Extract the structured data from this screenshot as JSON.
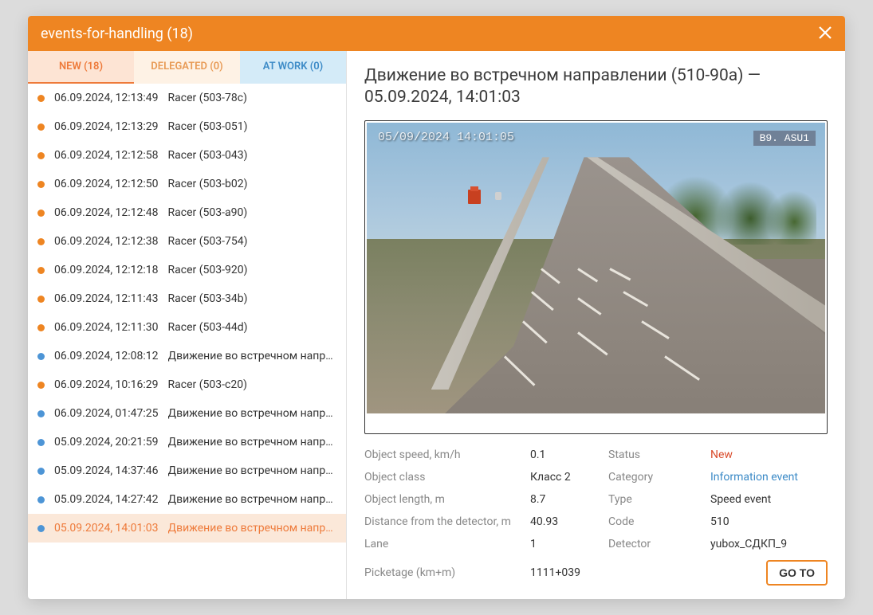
{
  "header": {
    "title": "events-for-handling (18)"
  },
  "tabs": {
    "new": "NEW (18)",
    "delegated": "DELEGATED (0)",
    "atwork": "AT WORK (0)"
  },
  "events": [
    {
      "ts": "06.09.2024, 12:13:49",
      "desc": "Racer (503-78c)",
      "color": "orange",
      "selected": false
    },
    {
      "ts": "06.09.2024, 12:13:29",
      "desc": "Racer (503-051)",
      "color": "orange",
      "selected": false
    },
    {
      "ts": "06.09.2024, 12:12:58",
      "desc": "Racer (503-043)",
      "color": "orange",
      "selected": false
    },
    {
      "ts": "06.09.2024, 12:12:50",
      "desc": "Racer (503-b02)",
      "color": "orange",
      "selected": false
    },
    {
      "ts": "06.09.2024, 12:12:48",
      "desc": "Racer (503-a90)",
      "color": "orange",
      "selected": false
    },
    {
      "ts": "06.09.2024, 12:12:38",
      "desc": "Racer (503-754)",
      "color": "orange",
      "selected": false
    },
    {
      "ts": "06.09.2024, 12:12:18",
      "desc": "Racer (503-920)",
      "color": "orange",
      "selected": false
    },
    {
      "ts": "06.09.2024, 12:11:43",
      "desc": "Racer (503-34b)",
      "color": "orange",
      "selected": false
    },
    {
      "ts": "06.09.2024, 12:11:30",
      "desc": "Racer (503-44d)",
      "color": "orange",
      "selected": false
    },
    {
      "ts": "06.09.2024, 12:08:12",
      "desc": "Движение во встречном напр…",
      "color": "blue",
      "selected": false
    },
    {
      "ts": "06.09.2024, 10:16:29",
      "desc": "Racer (503-c20)",
      "color": "orange",
      "selected": false
    },
    {
      "ts": "06.09.2024, 01:47:25",
      "desc": "Движение во встречном напр…",
      "color": "blue",
      "selected": false
    },
    {
      "ts": "05.09.2024, 20:21:59",
      "desc": "Движение во встречном напр…",
      "color": "blue",
      "selected": false
    },
    {
      "ts": "05.09.2024, 14:37:46",
      "desc": "Движение во встречном напр…",
      "color": "blue",
      "selected": false
    },
    {
      "ts": "05.09.2024, 14:27:42",
      "desc": "Движение во встречном напр…",
      "color": "blue",
      "selected": false
    },
    {
      "ts": "05.09.2024, 14:01:03",
      "desc": "Движение во встречном напр…",
      "color": "blue",
      "selected": true
    }
  ],
  "detail": {
    "title": "Движение во встречном направлении (510-90a) — 05.09.2024, 14:01:03",
    "camera": {
      "overlay_ts": "05/09/2024 14:01:05",
      "overlay_src": "B9. ASU1"
    },
    "labels": {
      "object_speed": "Object speed, km/h",
      "object_class": "Object class",
      "object_length": "Object length, m",
      "distance": "Distance from the detector, m",
      "lane": "Lane",
      "picketage": "Picketage (km+m)",
      "status": "Status",
      "category": "Category",
      "type": "Type",
      "code": "Code",
      "detector": "Detector"
    },
    "values": {
      "object_speed": "0.1",
      "object_class": "Класс 2",
      "object_length": "8.7",
      "distance": "40.93",
      "lane": "1",
      "picketage": "1111+039",
      "status": "New",
      "category": "Information event",
      "type": "Speed event",
      "code": "510",
      "detector": "yubox_СДКП_9"
    },
    "goto_label": "GO TO"
  }
}
